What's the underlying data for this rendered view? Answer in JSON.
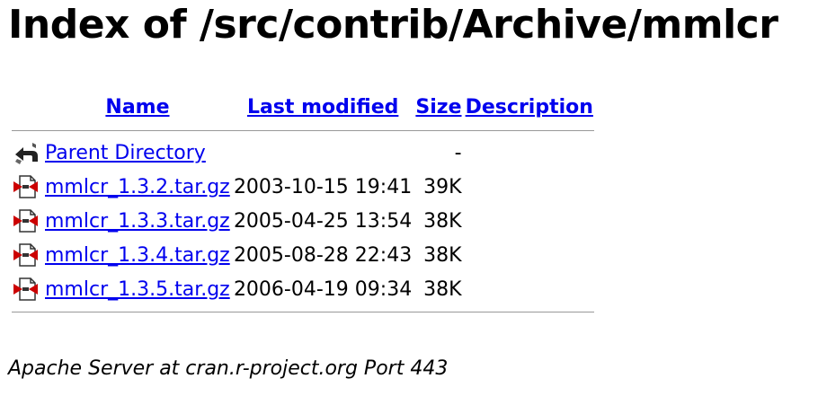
{
  "title": "Index of /src/contrib/Archive/mmlcr",
  "columns": {
    "name": "Name",
    "last_modified": "Last modified",
    "size": "Size",
    "description": "Description"
  },
  "parent": {
    "icon": "back-icon",
    "name": "Parent Directory",
    "last_modified": "",
    "size": "-"
  },
  "files": [
    {
      "icon": "archive-icon",
      "name": "mmlcr_1.3.2.tar.gz",
      "last_modified": "2003-10-15 19:41",
      "size": "39K"
    },
    {
      "icon": "archive-icon",
      "name": "mmlcr_1.3.3.tar.gz",
      "last_modified": "2005-04-25 13:54",
      "size": "38K"
    },
    {
      "icon": "archive-icon",
      "name": "mmlcr_1.3.4.tar.gz",
      "last_modified": "2005-08-28 22:43",
      "size": "38K"
    },
    {
      "icon": "archive-icon",
      "name": "mmlcr_1.3.5.tar.gz",
      "last_modified": "2006-04-19 09:34",
      "size": "38K"
    }
  ],
  "footer": "Apache Server at cran.r-project.org Port 443",
  "colors": {
    "link": "#0000ee",
    "rule": "#999999",
    "archive_red": "#cc0000"
  }
}
